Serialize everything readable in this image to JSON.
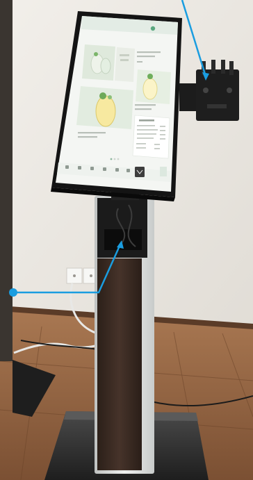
{
  "scene": {
    "subject": "kiosk-stand-with-touchscreen",
    "colors": {
      "wall": "#ece8e2",
      "floor": "#9a6a44",
      "floor_dark": "#6a4128",
      "column_wood": "#3a2a1f",
      "column_metal": "#d8dad8",
      "bezel": "#141414",
      "screen_bg": "#f4f6f3",
      "callout": "#1a9de0"
    },
    "callouts": [
      {
        "target": "card-reader-bracket"
      },
      {
        "target": "cable-compartment"
      }
    ]
  },
  "screen": {
    "logo_text": "",
    "nav_icons": [
      "menu-tile-icon",
      "menu-tile-icon",
      "menu-tile-icon",
      "menu-tile-icon",
      "menu-tile-icon",
      "menu-tile-icon",
      "menu-tile-icon",
      "order-button-icon"
    ]
  }
}
